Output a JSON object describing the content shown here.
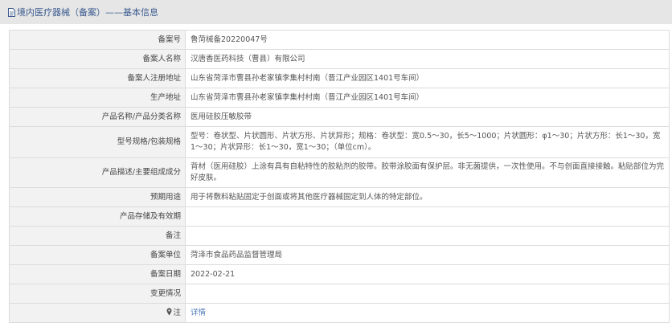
{
  "header": {
    "title": "境内医疗器械（备案）——基本信息",
    "icon": "document-icon"
  },
  "rows": [
    {
      "label": "备案号",
      "value": "鲁菏械备20220047号"
    },
    {
      "label": "备案人名称",
      "value": "汉唐香医药科技（曹县）有限公司"
    },
    {
      "label": "备案人注册地址",
      "value": "山东省菏泽市曹县孙老家镇李集村村南（晋江产业园区1401号车间）"
    },
    {
      "label": "生产地址",
      "value": "山东省菏泽市曹县孙老家镇李集村村南（晋江产业园区1401号车间）"
    },
    {
      "label": "产品名称/产品分类名称",
      "value": "医用硅胶压敏胶带"
    },
    {
      "label": "型号规格/包装规格",
      "value": "型号：卷状型、片状圆形、片状方形、片状异形；规格：卷状型：宽0.5～30，长5～1000；片状圆形：φ1～30；片状方形：长1～30，宽1～30；片状异形：长1～30，宽1～30；（单位cm）。"
    },
    {
      "label": "产品描述/主要组成成分",
      "value": "背材（医用硅胶）上涂有具有自粘特性的胶粘剂的胶带。胶带涂胶面有保护层。非无菌提供，一次性使用。不与创面直接接触。粘贴部位为完好皮肤。"
    },
    {
      "label": "预期用途",
      "value": "用于将敷料粘贴固定于创面或将其他医疗器械固定到人体的特定部位。"
    },
    {
      "label": "产品存储及有效期",
      "value": ""
    },
    {
      "label": "备注",
      "value": ""
    },
    {
      "label": "备案单位",
      "value": "菏泽市食品药品监督管理局"
    },
    {
      "label": "备案日期",
      "value": "2022-02-21"
    },
    {
      "label": "变更情况",
      "value": ""
    },
    {
      "label": "注",
      "value": "详情",
      "icon": "pin-icon"
    }
  ],
  "colors": {
    "header_bg": "#e6e6e6",
    "header_text": "#3a5a8f",
    "label_bg": "#f2f2f2",
    "border": "#dcdcdc",
    "link": "#4a76b8"
  }
}
